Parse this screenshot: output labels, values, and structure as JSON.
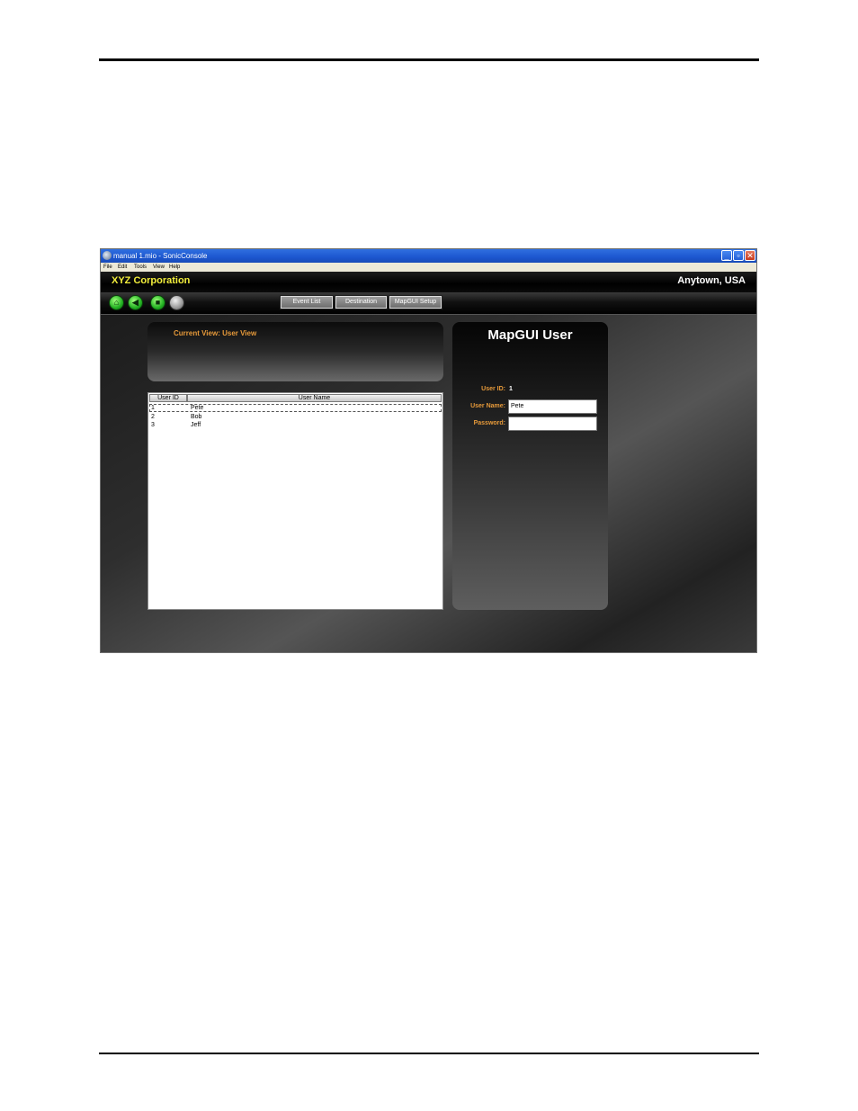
{
  "window": {
    "title": "manual 1.mio - SonicConsole",
    "buttons": {
      "minimize": "_",
      "maximize": "▫",
      "close": "✕"
    }
  },
  "menu": [
    "File",
    "Edit",
    "Tools",
    "View",
    "Help"
  ],
  "brand": {
    "company": "XYZ Corporation",
    "location": "Anytown, USA"
  },
  "nav_icons": [
    "home-icon",
    "back-icon",
    "stop-icon",
    "disabled-icon"
  ],
  "tabs": [
    "Event List",
    "Destination",
    "MapGUI Setup"
  ],
  "view": {
    "current": "Current View: User View"
  },
  "table": {
    "columns": [
      "User ID",
      "User Name"
    ],
    "rows": [
      {
        "id": "1",
        "name": "Pete"
      },
      {
        "id": "2",
        "name": "Bob"
      },
      {
        "id": "3",
        "name": "Jeff"
      }
    ]
  },
  "panel": {
    "title": "MapGUI User",
    "user_id_label": "User ID:",
    "user_id_value": "1",
    "user_name_label": "User Name:",
    "user_name_value": "Pete",
    "password_label": "Password:",
    "password_value": ""
  },
  "colors": {
    "brand": "#f2ee3b",
    "label_orange": "#e79a3a",
    "titlebar": "#1c56cf"
  }
}
